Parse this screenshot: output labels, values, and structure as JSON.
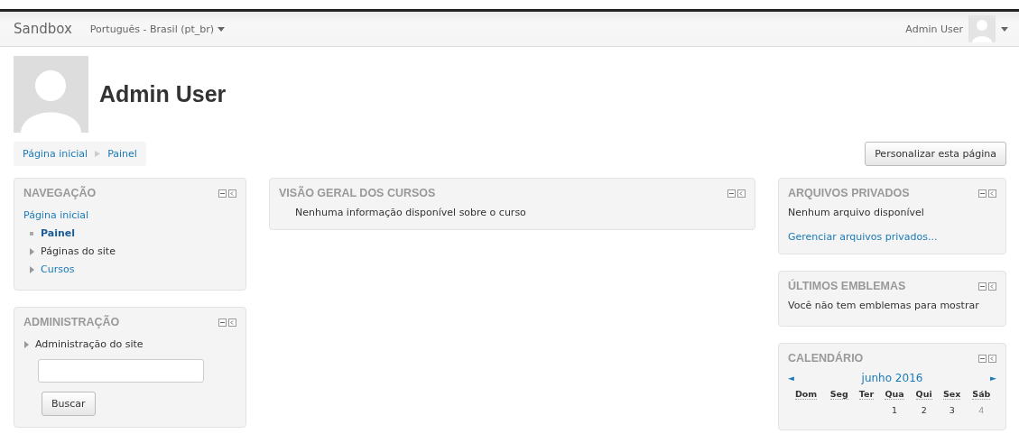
{
  "navbar": {
    "brand": "Sandbox",
    "language": "Português - Brasil (pt_br)",
    "user": "Admin User"
  },
  "header": {
    "name": "Admin User"
  },
  "breadcrumb": [
    "Página inicial",
    "Painel"
  ],
  "customize_button": "Personalizar esta página",
  "navigation": {
    "title": "NAVEGAÇÃO",
    "items": [
      {
        "label": "Página inicial",
        "kind": "link",
        "children": [
          {
            "label": "Painel",
            "kind": "current"
          },
          {
            "label": "Páginas do site",
            "kind": "branch"
          },
          {
            "label": "Cursos",
            "kind": "branch-link"
          }
        ]
      }
    ]
  },
  "administration": {
    "title": "ADMINISTRAÇÃO",
    "items": [
      {
        "label": "Administração do site",
        "kind": "branch"
      }
    ],
    "search_button": "Buscar"
  },
  "course_overview": {
    "title": "VISÃO GERAL DOS CURSOS",
    "message": "Nenhuma informação disponível sobre o curso"
  },
  "private_files": {
    "title": "ARQUIVOS PRIVADOS",
    "message": "Nenhum arquivo disponível",
    "link": "Gerenciar arquivos privados..."
  },
  "badges": {
    "title": "ÚLTIMOS EMBLEMAS",
    "message": "Você não tem emblemas para mostrar"
  },
  "calendar": {
    "title": "CALENDÁRIO",
    "prev": "◄",
    "month": "junho 2016",
    "next": "►",
    "weekdays": [
      "Dom",
      "Seg",
      "Ter",
      "Qua",
      "Qui",
      "Sex",
      "Sáb"
    ],
    "weeks": [
      {
        "padded_start": true,
        "days": [
          {
            "day": "1",
            "weekend": false
          },
          {
            "day": "2",
            "weekend": false
          },
          {
            "day": "3",
            "weekend": false
          },
          {
            "day": "4",
            "weekend": true
          }
        ]
      }
    ]
  }
}
